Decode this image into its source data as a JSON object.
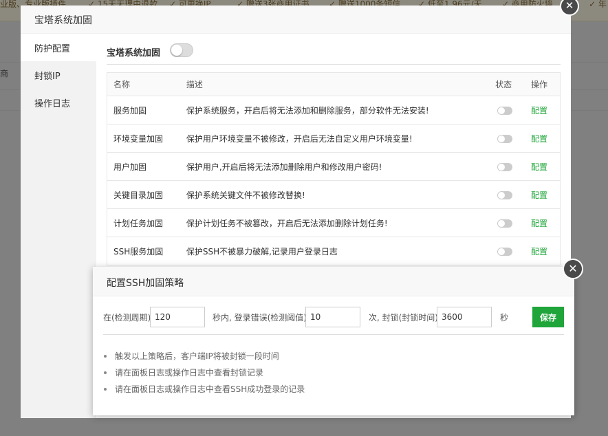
{
  "background": {
    "topbar_items": [
      "业版、专业版插件",
      "✓ 15天无理由退款",
      "✓ 可更换IP",
      "✓ 赠送3张商用证书",
      "✓ 赠送1000条短信",
      "✓ 低至1.96元/天",
      "✓ 商用防火墙"
    ],
    "topbar_right": "✓ 年",
    "row_text": "商"
  },
  "main_dialog": {
    "title": "宝塔系统加固",
    "sidebar": [
      {
        "label": "防护配置",
        "active": true
      },
      {
        "label": "封锁IP",
        "active": false
      },
      {
        "label": "操作日志",
        "active": false
      }
    ],
    "section_label": "宝塔系统加固",
    "master_toggle": false,
    "table": {
      "headers": [
        "名称",
        "描述",
        "状态",
        "操作"
      ],
      "rows": [
        {
          "name": "服务加固",
          "desc": "保护系统服务，开启后将无法添加和删除服务，部分软件无法安装!",
          "status": false,
          "action": "配置"
        },
        {
          "name": "环境变量加固",
          "desc": "保护用户环境变量不被修改，开启后无法自定义用户环境变量!",
          "status": false,
          "action": "配置"
        },
        {
          "name": "用户加固",
          "desc": "保护用户,开启后将无法添加删除用户和修改用户密码!",
          "status": false,
          "action": "配置"
        },
        {
          "name": "关键目录加固",
          "desc": "保护系统关键文件不被修改替换!",
          "status": false,
          "action": "配置"
        },
        {
          "name": "计划任务加固",
          "desc": "保护计划任务不被篡改，开启后无法添加删除计划任务!",
          "status": false,
          "action": "配置"
        },
        {
          "name": "SSH服务加固",
          "desc": "保护SSH不被暴力破解,记录用户登录日志",
          "status": false,
          "action": "配置"
        }
      ]
    }
  },
  "ssh_dialog": {
    "title": "配置SSH加固策略",
    "label_period": "在(检测周期)",
    "period_value": "120",
    "label_threshold": "秒内, 登录错误(检测阈值)",
    "threshold_value": "10",
    "label_block": "次, 封锁(封锁时间)",
    "block_value": "3600",
    "label_seconds": "秒",
    "save_label": "保存",
    "tips": [
      "触发以上策略后，客户端IP将被封锁一段时间",
      "请在面板日志或操作日志中查看封锁记录",
      "请在面板日志或操作日志中查看SSH成功登录的记录"
    ]
  },
  "colors": {
    "accent": "#20a53a",
    "overlay": "rgba(0,0,0,0.45)"
  },
  "icons": {
    "close": "close-icon"
  }
}
